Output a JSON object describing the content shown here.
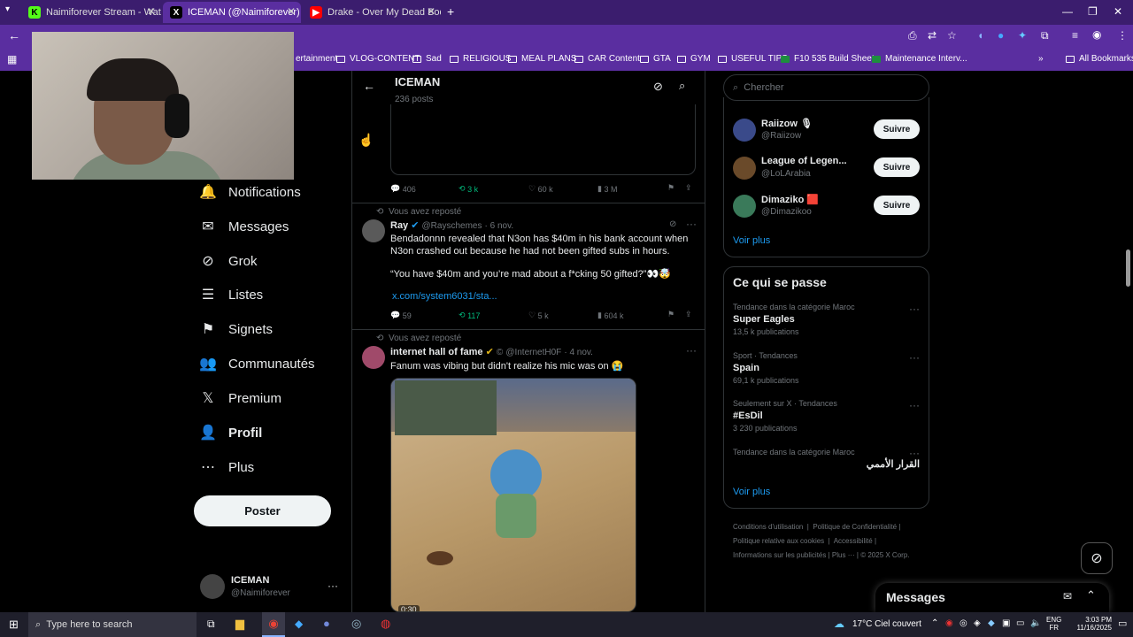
{
  "tabs": [
    {
      "title": "Naimiforever Stream - Watch Li",
      "favicon": "K",
      "fav_color": "#53fc18",
      "active": false
    },
    {
      "title": "ICEMAN (@Naimiforever) / X",
      "favicon": "X",
      "fav_color": "#000000",
      "active": true
    },
    {
      "title": "Drake - Over My Dead Body (S",
      "favicon": "▶",
      "fav_color": "#ff0000",
      "active": false
    }
  ],
  "bookmarks": [
    "ertainment",
    "VLOG-CONTENT",
    "Sad",
    "RELIGIOUS",
    "MEAL PLANS",
    "CAR Content",
    "GTA",
    "GYM",
    "USEFUL TIPS",
    "F10 535 Build Sheet...",
    "Maintenance Interv...",
    "All Bookmarks"
  ],
  "nav": [
    {
      "label": "Notifications",
      "icon": "bell-icon",
      "glyph": "🔔"
    },
    {
      "label": "Messages",
      "icon": "envelope-icon",
      "glyph": "✉"
    },
    {
      "label": "Grok",
      "icon": "grok-icon",
      "glyph": "⊘"
    },
    {
      "label": "Listes",
      "icon": "list-icon",
      "glyph": "☰"
    },
    {
      "label": "Signets",
      "icon": "bookmark-icon",
      "glyph": "⚑"
    },
    {
      "label": "Communautés",
      "icon": "community-icon",
      "glyph": "👥"
    },
    {
      "label": "Premium",
      "icon": "x-logo-icon",
      "glyph": "𝕏"
    },
    {
      "label": "Profil",
      "icon": "profile-icon",
      "glyph": "👤"
    },
    {
      "label": "Plus",
      "icon": "more-circle-icon",
      "glyph": "⋯"
    }
  ],
  "poster_label": "Poster",
  "account": {
    "name": "ICEMAN",
    "handle": "@Naimiforever"
  },
  "profile_header": {
    "name": "ICEMAN",
    "posts": "236 posts"
  },
  "post1_actions": {
    "replies": "406",
    "reposts": "3 k",
    "likes": "60 k",
    "views": "3 M"
  },
  "post2": {
    "reposted": "Vous avez reposté",
    "name": "Ray",
    "handle": "@Rayschemes",
    "date": "· 6 nov.",
    "text1": "Bendadonnn revealed that N3on has $40m in his bank account when N3on crashed out because he had not been gifted subs in hours.",
    "text2": "“You have $40m and you’re mad about a f*cking 50 gifted?”👀🤯",
    "link": "x.com/system6031/sta...",
    "replies": "59",
    "reposts": "117",
    "likes": "5 k",
    "views": "604 k"
  },
  "post3": {
    "reposted": "Vous avez reposté",
    "name": "internet hall of fame",
    "handle": "@InternetH0F",
    "date": "· 4 nov.",
    "text": "Fanum was vibing but didn't realize his mic was on 😭",
    "video_time": "0:30"
  },
  "search_placeholder": "Chercher",
  "suggestions": [
    {
      "name": "Raiizow 🎙",
      "handle": "@Raiizow",
      "color": "#3a4a8a"
    },
    {
      "name": "League of Legen...",
      "handle": "@LoLArabia",
      "color": "#6a4a2a"
    },
    {
      "name": "Dimaziko 🟥",
      "handle": "@Dimazikoo",
      "color": "#3a7a5a"
    }
  ],
  "follow_label": "Suivre",
  "voir_plus": "Voir plus",
  "trends_title": "Ce qui se passe",
  "trends": [
    {
      "context": "Tendance dans la catégorie Maroc",
      "title": "Super Eagles",
      "count": "13,5 k publications"
    },
    {
      "context": "Sport · Tendances",
      "title": "Spain",
      "count": "69,1 k publications"
    },
    {
      "context": "Seulement sur X · Tendances",
      "title": "#EsDil",
      "count": "3 230 publications"
    },
    {
      "context": "Tendance dans la catégorie Maroc",
      "title": "القرار الأممي",
      "count": ""
    }
  ],
  "footer_links": [
    "Conditions d'utilisation",
    "Politique de Confidentialité",
    "Politique relative aux cookies",
    "Accessibilité",
    "Informations sur les publicités",
    "Plus ···",
    "© 2025 X Corp."
  ],
  "messages_label": "Messages",
  "taskbar": {
    "search": "Type here to search",
    "weather": "17°C  Ciel couvert",
    "lang1": "ENG",
    "lang2": "FR",
    "time": "3:03 PM",
    "date": "11/16/2025"
  }
}
